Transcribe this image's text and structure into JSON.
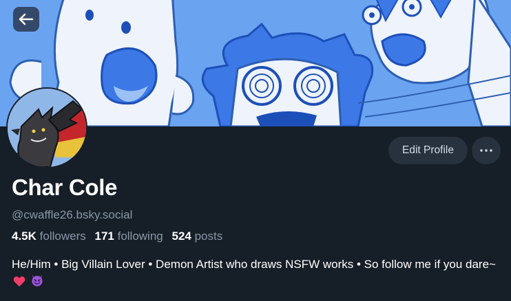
{
  "profile": {
    "display_name": "Char Cole",
    "handle": "@cwaffle26.bsky.social",
    "followers_count": "4.5K",
    "followers_label": "followers",
    "following_count": "171",
    "following_label": "following",
    "posts_count": "524",
    "posts_label": "posts",
    "bio": "He/Him • Big Villain Lover • Demon Artist who draws NSFW works • So follow me if you dare~",
    "bio_emojis": [
      "heart-emoji",
      "smiling-imp-emoji"
    ]
  },
  "actions": {
    "edit_profile_label": "Edit Profile",
    "more_icon": "ellipsis-icon",
    "back_icon": "arrow-left-icon"
  },
  "colors": {
    "background": "#161e27",
    "banner_blue": "#6aa3f0",
    "button_bg": "#28323f",
    "muted_text": "#8b98a8"
  }
}
